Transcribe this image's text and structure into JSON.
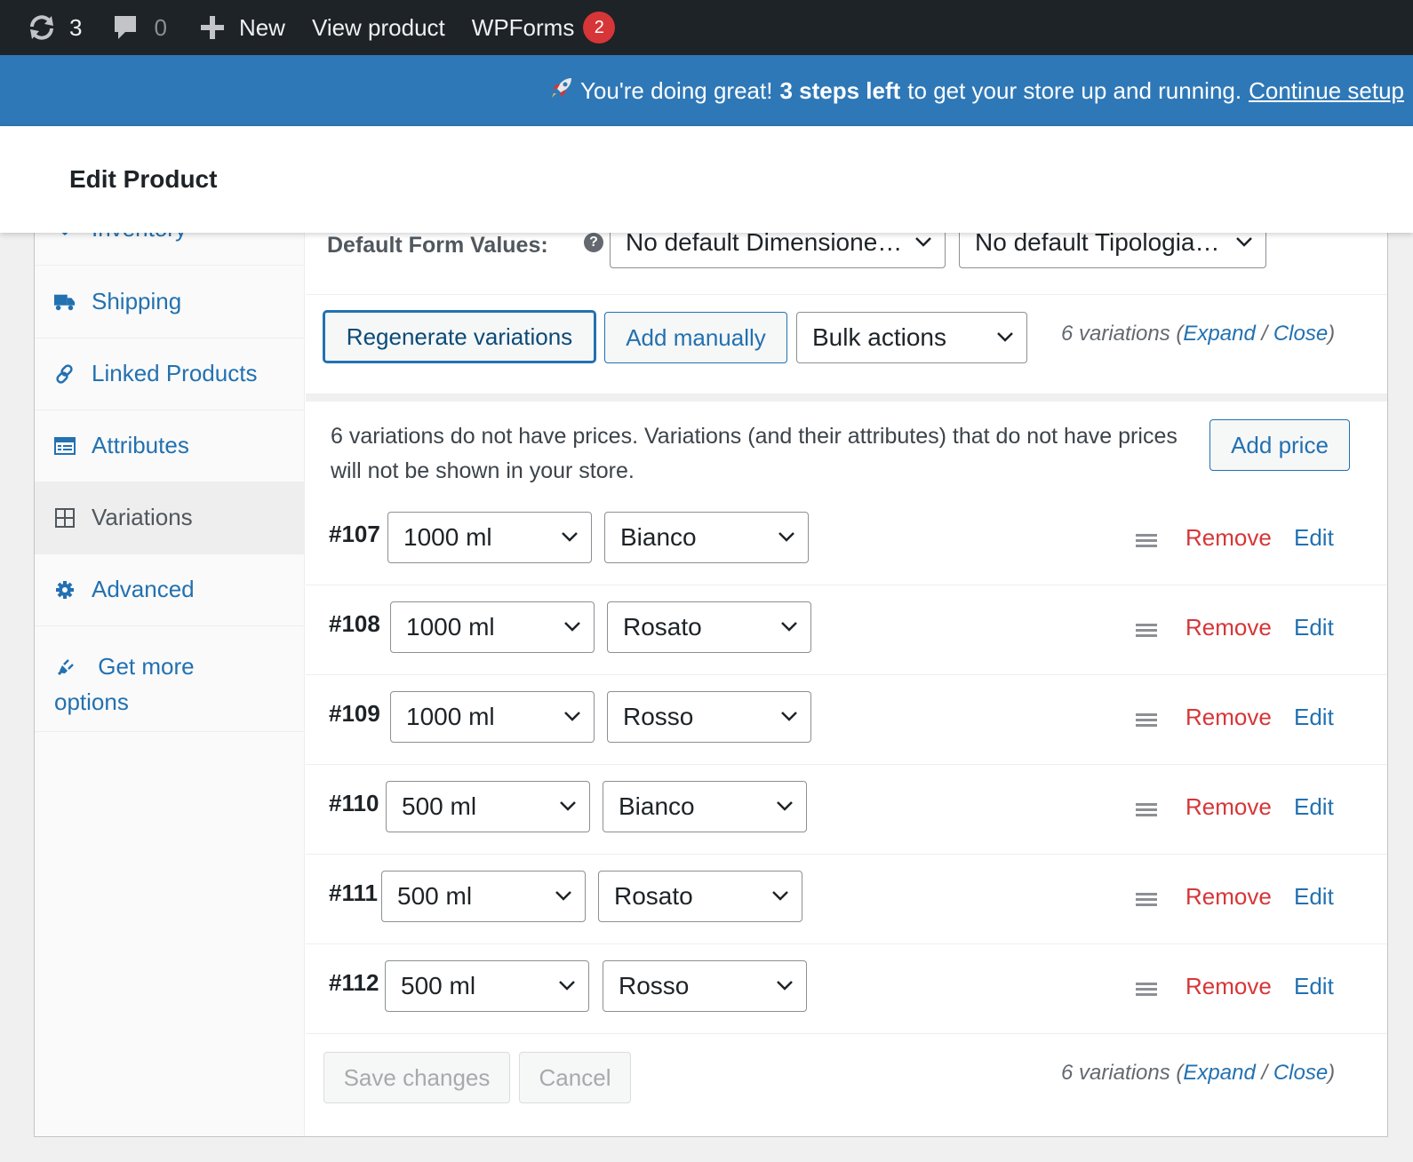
{
  "adminbar": {
    "updates_count": "3",
    "comments_count": "0",
    "new_label": "New",
    "view_product_label": "View product",
    "wpforms_label": "WPForms",
    "wpforms_badge": "2"
  },
  "notice": {
    "prefix": "You're doing great!",
    "bold": "3 steps left",
    "suffix": "to get your store up and running.",
    "link": "Continue setup"
  },
  "header": {
    "title": "Edit Product"
  },
  "sidebar": {
    "items": [
      {
        "label": "Inventory",
        "icon": "inventory-icon"
      },
      {
        "label": "Shipping",
        "icon": "truck-icon"
      },
      {
        "label": "Linked Products",
        "icon": "link-icon"
      },
      {
        "label": "Attributes",
        "icon": "list-icon"
      },
      {
        "label": "Variations",
        "icon": "grid-icon"
      },
      {
        "label": "Advanced",
        "icon": "gear-icon"
      },
      {
        "label": "Get more",
        "label2": "options",
        "icon": "plug-icon"
      }
    ]
  },
  "defaults": {
    "label": "Default Form Values:",
    "help": "?",
    "select1": "No default Dimensione…",
    "select2": "No default Tipologia…"
  },
  "toolbar": {
    "regenerate": "Regenerate variations",
    "add_manually": "Add manually",
    "bulk_actions": "Bulk actions",
    "count_text": "6 variations (",
    "expand": "Expand",
    "sep": " / ",
    "close": "Close",
    "end": ")"
  },
  "price_notice": {
    "text": "6 variations do not have prices. Variations (and their attributes) that do not have prices will not be shown in your store.",
    "button": "Add price"
  },
  "variations": [
    {
      "id": "#107",
      "size": "1000 ml",
      "type": "Bianco"
    },
    {
      "id": "#108",
      "size": "1000 ml",
      "type": "Rosato"
    },
    {
      "id": "#109",
      "size": "1000 ml",
      "type": "Rosso"
    },
    {
      "id": "#110",
      "size": "500 ml",
      "type": "Bianco"
    },
    {
      "id": "#111",
      "size": "500 ml",
      "type": "Rosato"
    },
    {
      "id": "#112",
      "size": "500 ml",
      "type": "Rosso"
    }
  ],
  "row_actions": {
    "remove": "Remove",
    "edit": "Edit"
  },
  "footer": {
    "save": "Save changes",
    "cancel": "Cancel"
  },
  "colors": {
    "adminbar": "#1d2327",
    "notice": "#2e78b7",
    "link": "#2271b1",
    "remove": "#d63638",
    "badge": "#d63638"
  }
}
